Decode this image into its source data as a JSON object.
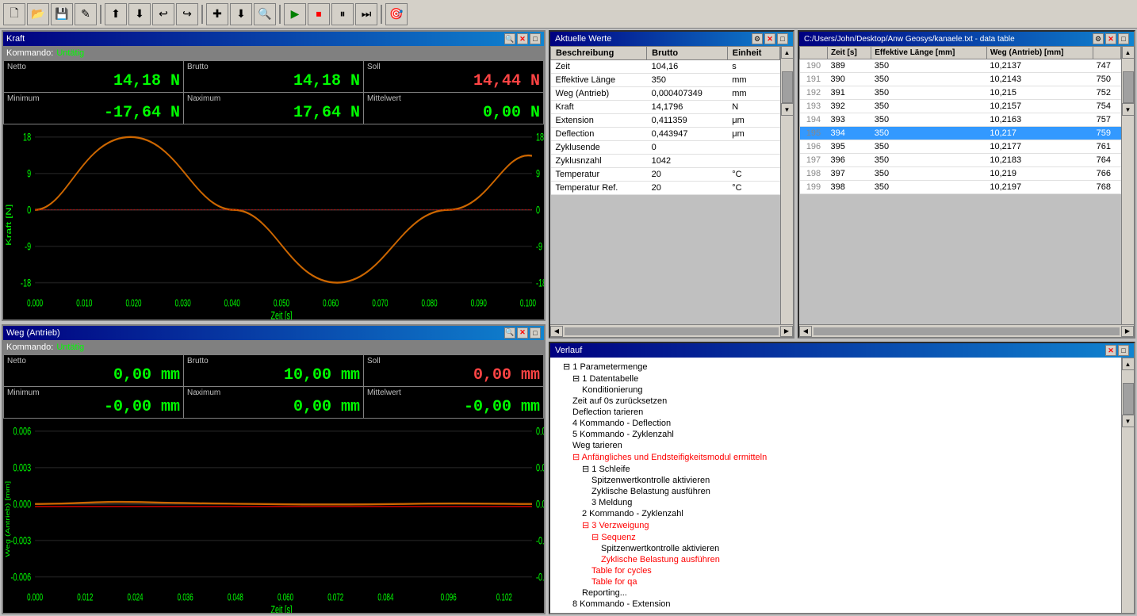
{
  "toolbar": {
    "buttons": [
      "🗋",
      "💾",
      "💾",
      "✎",
      "⬆",
      "⬇",
      "↩",
      "↪",
      "✚",
      "⬇",
      "↗",
      "🔍",
      "▶",
      "⛔",
      "⏸",
      "⏭",
      "🎯"
    ]
  },
  "kraft_panel": {
    "title": "Kraft",
    "kommando_label": "Kommando:",
    "kommando_status": "Untätig",
    "netto_label": "Netto",
    "brutto_label": "Brutto",
    "soll_label": "Soll",
    "netto_value": "14,18 N",
    "brutto_value": "14,18 N",
    "soll_value": "14,44 N",
    "minimum_label": "Minimum",
    "maximum_label": "Naximum",
    "mittelwert_label": "Mittelwert",
    "min_value": "-17,64 N",
    "max_value": "17,64 N",
    "mittelwert_value": "0,00 N",
    "chart_y_label": "Kraft [N]",
    "chart_x_label": "Zeit [s]",
    "x_ticks": [
      "0.000",
      "0.010",
      "0.020",
      "0.030",
      "0.040",
      "0.050",
      "0.060",
      "0.070",
      "0.080",
      "0.090",
      "0.100"
    ],
    "y_ticks": [
      "18",
      "9",
      "0",
      "-9",
      "-18"
    ]
  },
  "weg_panel": {
    "title": "Weg (Antrieb)",
    "kommando_label": "Kommando:",
    "kommando_status": "Untätig",
    "netto_label": "Netto",
    "brutto_label": "Brutto",
    "soll_label": "Soll",
    "netto_value": "0,00 mm",
    "brutto_value": "10,00 mm",
    "soll_value": "0,00 mm",
    "minimum_label": "Minimum",
    "maximum_label": "Naximum",
    "mittelwert_label": "Mittelwert",
    "min_value": "-0,00 mm",
    "max_value": "0,00 mm",
    "mittelwert_value": "-0,00 mm",
    "chart_y_label": "Weg (Antrieb) [mm]",
    "chart_x_label": "Zeit [s]",
    "x_ticks": [
      "0.000",
      "0.012",
      "0.024",
      "0.036",
      "0.048",
      "0.060",
      "0.072",
      "0.084",
      "0.096",
      "0.102"
    ],
    "y_ticks": [
      "0.006",
      "0.003",
      "0.000",
      "-0.003",
      "-0.006"
    ]
  },
  "aktuelle_werte": {
    "title": "Aktuelle Werte",
    "columns": [
      "Beschreibung",
      "Brutto",
      "Einheit"
    ],
    "rows": [
      {
        "beschreibung": "Zeit",
        "brutto": "104,16",
        "einheit": "s"
      },
      {
        "beschreibung": "Effektive Länge",
        "brutto": "350",
        "einheit": "mm"
      },
      {
        "beschreibung": "Weg (Antrieb)",
        "brutto": "0,000407349",
        "einheit": "mm"
      },
      {
        "beschreibung": "Kraft",
        "brutto": "14,1796",
        "einheit": "N"
      },
      {
        "beschreibung": "Extension",
        "brutto": "0,411359",
        "einheit": "μm"
      },
      {
        "beschreibung": "Deflection",
        "brutto": "0,443947",
        "einheit": "μm"
      },
      {
        "beschreibung": "Zyklusende",
        "brutto": "0",
        "einheit": ""
      },
      {
        "beschreibung": "Zyklusnzahl",
        "brutto": "1042",
        "einheit": ""
      },
      {
        "beschreibung": "Temperatur",
        "brutto": "20",
        "einheit": "°C"
      },
      {
        "beschreibung": "Temperatur Ref.",
        "brutto": "20",
        "einheit": "°C"
      }
    ]
  },
  "file_table": {
    "title": "C:/Users/John/Desktop/Anw Geosys/kanaele.txt - data table",
    "columns": [
      "Zeit [s]",
      "Effektive Länge [mm]",
      "Weg (Antrieb) [mm]"
    ],
    "rows": [
      {
        "idx": 190,
        "zeit": 389,
        "eff_lange": 350,
        "weg": "10,2137",
        "extra": "747"
      },
      {
        "idx": 191,
        "zeit": 390,
        "eff_lange": 350,
        "weg": "10,2143",
        "extra": "750"
      },
      {
        "idx": 192,
        "zeit": 391,
        "eff_lange": 350,
        "weg": "10,215",
        "extra": "752"
      },
      {
        "idx": 193,
        "zeit": 392,
        "eff_lange": 350,
        "weg": "10,2157",
        "extra": "754"
      },
      {
        "idx": 194,
        "zeit": 393,
        "eff_lange": 350,
        "weg": "10,2163",
        "extra": "757"
      },
      {
        "idx": 195,
        "zeit": 394,
        "eff_lange": 350,
        "weg": "10,217",
        "extra": "759",
        "selected": true
      },
      {
        "idx": 196,
        "zeit": 395,
        "eff_lange": 350,
        "weg": "10,2177",
        "extra": "761"
      },
      {
        "idx": 197,
        "zeit": 396,
        "eff_lange": 350,
        "weg": "10,2183",
        "extra": "764"
      },
      {
        "idx": 198,
        "zeit": 397,
        "eff_lange": 350,
        "weg": "10,219",
        "extra": "766"
      },
      {
        "idx": 199,
        "zeit": 398,
        "eff_lange": 350,
        "weg": "10,2197",
        "extra": "768"
      }
    ]
  },
  "verlauf": {
    "title": "Verlauf",
    "tree": [
      {
        "text": "⊟ 1 Parametermenge",
        "indent": 1
      },
      {
        "text": "⊟ 1 Datentabelle",
        "indent": 2
      },
      {
        "text": "Konditionierung",
        "indent": 3
      },
      {
        "text": "Zeit auf 0s zurücksetzen",
        "indent": 2
      },
      {
        "text": "Deflection tarieren",
        "indent": 2
      },
      {
        "text": "4 Kommando - Deflection",
        "indent": 2
      },
      {
        "text": "5 Kommando - Zyklenzahl",
        "indent": 2
      },
      {
        "text": "Weg tarieren",
        "indent": 2
      },
      {
        "text": "⊟ Anfängliches und Endsteifigkeitsmodul ermitteln",
        "indent": 2,
        "color": "red"
      },
      {
        "text": "⊟ 1 Schleife",
        "indent": 3
      },
      {
        "text": "Spitzenwertkontrolle aktivieren",
        "indent": 4
      },
      {
        "text": "Zyklische Belastung ausführen",
        "indent": 4
      },
      {
        "text": "3 Meldung",
        "indent": 4
      },
      {
        "text": "2 Kommando - Zyklenzahl",
        "indent": 3
      },
      {
        "text": "⊟ 3 Verzweigung",
        "indent": 3,
        "color": "red"
      },
      {
        "text": "⊟ Sequenz",
        "indent": 4,
        "color": "red"
      },
      {
        "text": "Spitzenwertkontrolle aktivieren",
        "indent": 5
      },
      {
        "text": "Zyklische Belastung ausführen",
        "indent": 5,
        "color": "red"
      },
      {
        "text": "Table for cycles",
        "indent": 4,
        "color": "red"
      },
      {
        "text": "Table for qa",
        "indent": 4,
        "color": "red"
      },
      {
        "text": "Reporting...",
        "indent": 3
      },
      {
        "text": "8 Kommando - Extension",
        "indent": 2
      }
    ]
  }
}
